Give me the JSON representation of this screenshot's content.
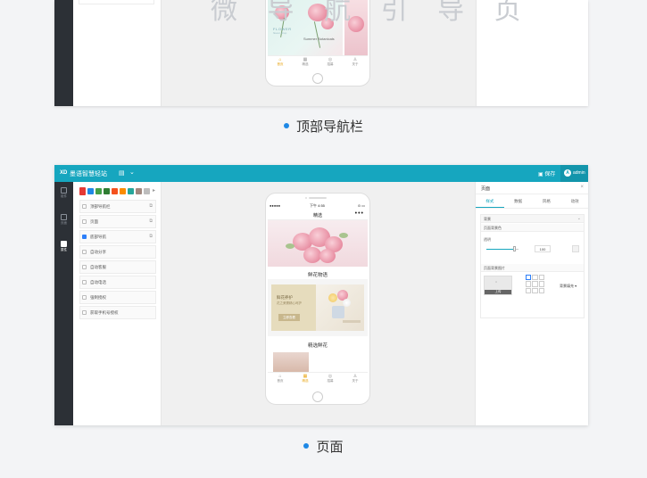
{
  "watermark": "微 导 航 引 导 页",
  "section1": {
    "caption": "顶部导航栏",
    "banner": {
      "brand": "FLOWER",
      "brand_sub": "flower shop",
      "text": "Summer Botanicals"
    },
    "tabs": [
      {
        "label": "首页",
        "icon": "home-icon",
        "glyph": "⌂",
        "active": true
      },
      {
        "label": "精选",
        "icon": "grid-icon",
        "glyph": "▦",
        "active": false
      },
      {
        "label": "招募",
        "icon": "compass-icon",
        "glyph": "◎",
        "active": false
      },
      {
        "label": "关于",
        "icon": "user-icon",
        "glyph": "♙",
        "active": false
      }
    ]
  },
  "section2": {
    "caption": "页面",
    "topbar": {
      "logo": "XD",
      "title": "墨语智慧轻站",
      "menu_icon": "▤",
      "chevron": "⌄",
      "save": "▣ 保存",
      "avatar": "A",
      "user": "admin"
    },
    "rail": [
      {
        "label": "组件",
        "icon": "component-icon",
        "active": false
      },
      {
        "label": "页面",
        "icon": "page-icon",
        "active": false
      },
      {
        "label": "属性",
        "icon": "property-icon",
        "active": true
      }
    ],
    "swatches": [
      "#e53935",
      "#1e88e5",
      "#43a047",
      "#2e7d32",
      "#f4511e",
      "#fb8c00",
      "#26a69a",
      "#a1887f",
      "#bdbdbd"
    ],
    "swatch_more": "▸",
    "components": [
      {
        "label": "顶部导航栏",
        "checked": false,
        "edit": "⧉"
      },
      {
        "label": "页面",
        "checked": false,
        "edit": "⧉"
      },
      {
        "label": "底部导航",
        "checked": true,
        "edit": "⧉"
      },
      {
        "label": "自动分享",
        "checked": false,
        "edit": ""
      },
      {
        "label": "自动客服",
        "checked": false,
        "edit": ""
      },
      {
        "label": "自动电话",
        "checked": false,
        "edit": ""
      },
      {
        "label": "强制授权",
        "checked": false,
        "edit": ""
      },
      {
        "label": "获取手机号授权",
        "checked": false,
        "edit": ""
      }
    ],
    "phone": {
      "signal": "●●●●●",
      "time": "下午 4:55",
      "battery": "⊙ ▭",
      "nav_title": "精选",
      "nav_menu": "•••",
      "section_a": "鲜花物语",
      "promo_title": "鲜花养护",
      "promo_sub": "花之美需精心呵护",
      "promo_btn": "立即查看",
      "section_b": "精选鲜花",
      "tabs": [
        {
          "label": "首页",
          "icon": "home-icon",
          "glyph": "⌂",
          "active": false
        },
        {
          "label": "精选",
          "icon": "grid-icon",
          "glyph": "▦",
          "active": true
        },
        {
          "label": "招募",
          "icon": "compass-icon",
          "glyph": "◎",
          "active": false
        },
        {
          "label": "关于",
          "icon": "user-icon",
          "glyph": "♙",
          "active": false
        }
      ]
    },
    "props": {
      "title": "页面",
      "close": "×",
      "tabs": [
        {
          "label": "样式",
          "active": true
        },
        {
          "label": "数据",
          "active": false
        },
        {
          "label": "风格",
          "active": false
        },
        {
          "label": "动效",
          "active": false
        }
      ],
      "group_main": "背景",
      "group_color": "页面背景色",
      "opacity_label": "透明",
      "opacity_value": "100",
      "opacity_fraction": 0.88,
      "group_image": "页面背景图片",
      "upload": "上传",
      "image_mode": "背景填充 ▾"
    }
  }
}
